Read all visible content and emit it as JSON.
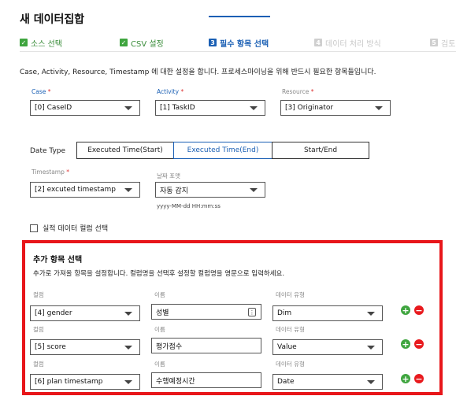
{
  "title": "새 데이터집합",
  "steps": [
    {
      "label": "소스 선택",
      "state": "done",
      "icon": "check-icon",
      "mark": "✓"
    },
    {
      "label": "CSV 설정",
      "state": "done",
      "icon": "check-icon",
      "mark": "✓"
    },
    {
      "label": "필수 항목 선택",
      "state": "active",
      "icon": "step-number",
      "mark": "3"
    },
    {
      "label": "데이터 처리 방식",
      "state": "todo",
      "icon": "step-number",
      "mark": "4"
    },
    {
      "label": "검토",
      "state": "todo",
      "icon": "step-number",
      "mark": "5"
    }
  ],
  "description": "Case, Activity, Resource, Timestamp 에 대한 설정을 합니다. 프로세스마이닝을 위해 반드시 필요한 항목들입니다.",
  "required_fields": {
    "case": {
      "label": "Case",
      "required_mark": "*",
      "value": "[0] CaseID"
    },
    "activity": {
      "label": "Activity",
      "required_mark": "*",
      "value": "[1] TaskID"
    },
    "resource": {
      "label": "Resource",
      "required_mark": "*",
      "value": "[3] Originator"
    }
  },
  "date_type": {
    "label": "Date Type",
    "options": [
      "Executed Time(Start)",
      "Executed Time(End)",
      "Start/End"
    ],
    "selected": "Executed Time(End)"
  },
  "timestamp": {
    "label": "Timestamp",
    "required_mark": "*",
    "value": "[2] excuted timestamp"
  },
  "date_format": {
    "label": "날짜 포맷",
    "value": "자동 감지",
    "hint": "yyyy-MM-dd HH:mm:ss"
  },
  "actual_data_checkbox": {
    "label": "실적 데이터 컬럼 선택",
    "checked": false
  },
  "additional": {
    "title": "추가 항목 선택",
    "description": "추가로 가져올 항목을 설정합니다. 컬럼명을 선택후 설정할 컬럼명을 영문으로 입력하세요.",
    "column_label": "컬럼",
    "name_label": "이름",
    "type_label": "데이터 유형",
    "rows": [
      {
        "column": "[4] gender",
        "name": "성별",
        "type": "Dim"
      },
      {
        "column": "[5] score",
        "name": "평가점수",
        "type": "Value"
      },
      {
        "column": "[6] plan timestamp",
        "name": "수행예정시간",
        "type": "Date"
      }
    ],
    "add_symbol": "+",
    "remove_symbol": "−"
  },
  "colors": {
    "accent": "#1a5fb4",
    "done": "#3fa53f",
    "highlight": "#e8161a",
    "remove": "#e81a1e"
  }
}
